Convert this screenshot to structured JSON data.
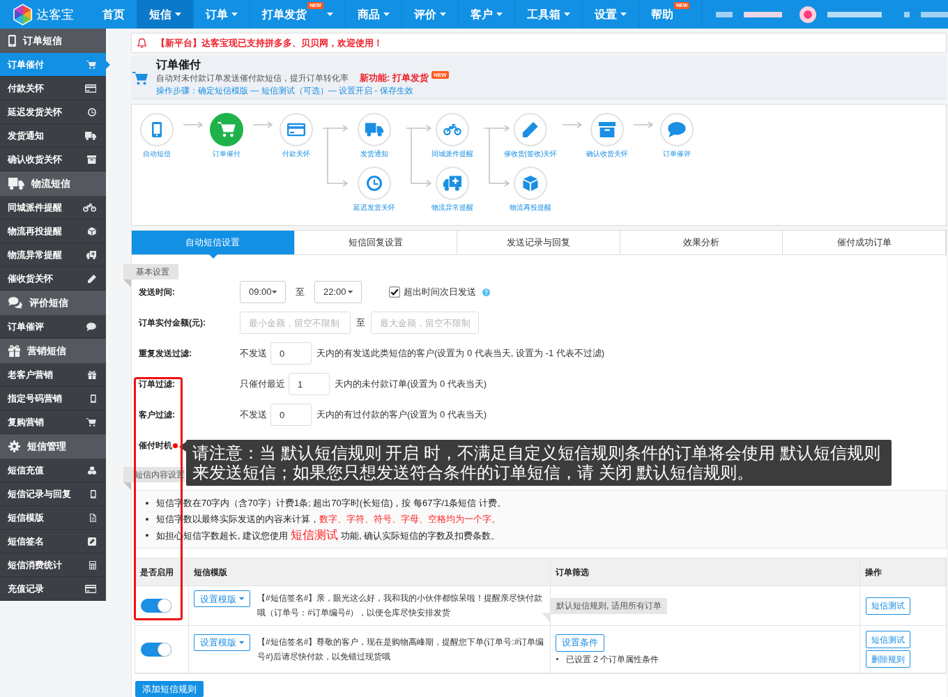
{
  "nav": {
    "logo": "达客宝",
    "items": [
      {
        "label": "首页",
        "selected": false,
        "dropdown": false
      },
      {
        "label": "短信",
        "selected": true,
        "dropdown": true
      },
      {
        "label": "订单",
        "selected": false,
        "dropdown": true
      },
      {
        "label": "打单发货",
        "selected": false,
        "dropdown": true,
        "badge": "NEW"
      },
      {
        "label": "商品",
        "selected": false,
        "dropdown": true
      },
      {
        "label": "评价",
        "selected": false,
        "dropdown": true
      },
      {
        "label": "客户",
        "selected": false,
        "dropdown": true
      },
      {
        "label": "工具箱",
        "selected": false,
        "dropdown": true
      },
      {
        "label": "设置",
        "selected": false,
        "dropdown": true
      },
      {
        "label": "帮助",
        "selected": false,
        "dropdown": false,
        "badge": "NEW"
      }
    ]
  },
  "sidebar": {
    "sections": [
      {
        "title": "订单短信",
        "items": [
          {
            "label": "订单催付",
            "selected": true
          },
          {
            "label": "付款关怀",
            "selected": false
          },
          {
            "label": "延迟发货关怀",
            "selected": false
          },
          {
            "label": "发货通知",
            "selected": false
          },
          {
            "label": "确认收货关怀",
            "selected": false
          }
        ]
      },
      {
        "title": "物流短信",
        "items": [
          {
            "label": "同城派件提醒",
            "selected": false
          },
          {
            "label": "物流再投提醒",
            "selected": false
          },
          {
            "label": "物流异常提醒",
            "selected": false
          },
          {
            "label": "催收货关怀",
            "selected": false
          }
        ]
      },
      {
        "title": "评价短信",
        "items": [
          {
            "label": "订单催评",
            "selected": false
          }
        ]
      },
      {
        "title": "营销短信",
        "items": [
          {
            "label": "老客户营销",
            "selected": false
          },
          {
            "label": "指定号码营销",
            "selected": false
          },
          {
            "label": "复购营销",
            "selected": false
          }
        ]
      },
      {
        "title": "短信管理",
        "items": [
          {
            "label": "短信充值",
            "selected": false
          },
          {
            "label": "短信记录与回复",
            "selected": false
          },
          {
            "label": "短信模版",
            "selected": false
          },
          {
            "label": "短信签名",
            "selected": false
          },
          {
            "label": "短信消费统计",
            "selected": false
          },
          {
            "label": "充值记录",
            "selected": false
          }
        ]
      }
    ]
  },
  "notice": {
    "text": "【新平台】达客宝现已支持拼多多、贝贝网，欢迎使用！"
  },
  "page_header": {
    "title": "订单催付",
    "description": "自动对未付款订单发送催付款短信，提升订单转化率",
    "feature_link": "新功能: 打单发货",
    "feature_badge": "NEW",
    "steps": "操作步骤：确定短信模版 — 短信测试（可选）— 设置开启 - 保存生效"
  },
  "workflow": {
    "columns": [
      {
        "nodes": [
          {
            "label": "自动短信",
            "selected": false
          }
        ]
      },
      {
        "nodes": [
          {
            "label": "订单催付",
            "selected": true
          }
        ]
      },
      {
        "nodes": [
          {
            "label": "付款关怀",
            "selected": false
          }
        ]
      },
      {
        "nodes": [
          {
            "label": "发货通知",
            "selected": false
          },
          {
            "label": "延迟发货关怀",
            "selected": false
          }
        ]
      },
      {
        "nodes": [
          {
            "label": "同城派件提醒",
            "selected": false
          },
          {
            "label": "物流异常提醒",
            "selected": false
          }
        ]
      },
      {
        "nodes": [
          {
            "label": "催收货(签收)关怀",
            "selected": false
          },
          {
            "label": "物流再投提醒",
            "selected": false
          }
        ]
      },
      {
        "nodes": [
          {
            "label": "确认收货关怀",
            "selected": false
          }
        ]
      },
      {
        "nodes": [
          {
            "label": "订单催评",
            "selected": false
          }
        ]
      }
    ]
  },
  "tabs": [
    {
      "label": "自动短信设置",
      "selected": true
    },
    {
      "label": "短信回复设置",
      "selected": false
    },
    {
      "label": "发送记录与回复",
      "selected": false
    },
    {
      "label": "效果分析",
      "selected": false
    },
    {
      "label": "催付成功订单",
      "selected": false
    }
  ],
  "basic_settings": {
    "title": "基本设置",
    "rows": [
      {
        "kind": "time_range",
        "label": "发送时间:",
        "from": "09:00",
        "separator": "至",
        "to": "22:00",
        "checkbox": {
          "label": "超出时间次日发送",
          "checked": true
        }
      },
      {
        "kind": "amount_range",
        "label": "订单实付金额(元):",
        "min_placeholder": "最小金额，留空不限制",
        "separator": "至",
        "max_placeholder": "最大金额，留空不限制"
      },
      {
        "kind": "number",
        "label": "重复发送过滤:",
        "prefix": "不发送",
        "value": "0",
        "suffix": "天内的有发送此类短信的客户(设置为 0 代表当天, 设置为 -1 代表不过滤)"
      },
      {
        "kind": "number",
        "label": "订单过滤:",
        "prefix": "只催付最近",
        "value": "1",
        "suffix": "天内的未付款订单(设置为 0 代表当天)"
      },
      {
        "kind": "number",
        "label": "客户过滤:",
        "prefix": "不发送",
        "value": "0",
        "suffix": "天内的有过付款的客户(设置为 0 代表当天)"
      },
      {
        "kind": "timing",
        "label": "催付时机",
        "tooltip": "请注意：当 默认短信规则 开启 时，不满足自定义短信规则条件的订单将会使用 默认短信规则来发送短信；如果您只想发送符合条件的订单短信，请 关闭 默认短信规则。"
      }
    ]
  },
  "content_settings": {
    "title": "短信内容设置",
    "notes": [
      {
        "segments": [
          {
            "kind": "text",
            "text": "短信字数在70字内（含70字）计费1条; 超出70字时(长短信)，按 每67字/1条短信 计费。"
          }
        ]
      },
      {
        "segments": [
          {
            "kind": "text",
            "text": "短信字数以最终实际发送的内容来计算，"
          },
          {
            "kind": "warning",
            "text": "数字、字符、符号、字母、空格均为一个字。"
          }
        ]
      },
      {
        "segments": [
          {
            "kind": "text",
            "text": "如担心短信字数超长, 建议您使用"
          },
          {
            "kind": "link",
            "text": "短信测试"
          },
          {
            "kind": "text",
            "text": "功能, 确认实际短信的字数及扣费条数。"
          }
        ]
      }
    ]
  },
  "rules_table": {
    "columns": [
      "是否启用",
      "短信模版",
      "订单筛选",
      "操作"
    ],
    "rows": [
      {
        "on": true,
        "template_button": "设置模版",
        "template": "【#短信签名#】亲，眼光这么好，我和我的小伙伴都惊呆啦！提醒亲尽快付款哦（订单号：#订单编号#），以便仓库尽快安排发货",
        "filter": {
          "kind": "note",
          "text": "默认短信规则, 适用所有订单"
        },
        "actions": [
          "短信测试"
        ]
      },
      {
        "on": true,
        "template_button": "设置模版",
        "template": "【#短信签名#】尊敬的客户，现在是购物高峰期，提醒您下单(订单号:#订单编号#)后请尽快付款，以免错过现货哦",
        "filter": {
          "kind": "conditions",
          "button": "设置条件",
          "items": [
            "已设置 2 个订单属性条件"
          ]
        },
        "actions": [
          "短信测试",
          "删除规则"
        ]
      }
    ]
  },
  "add_rule_button": "添加短信规则"
}
